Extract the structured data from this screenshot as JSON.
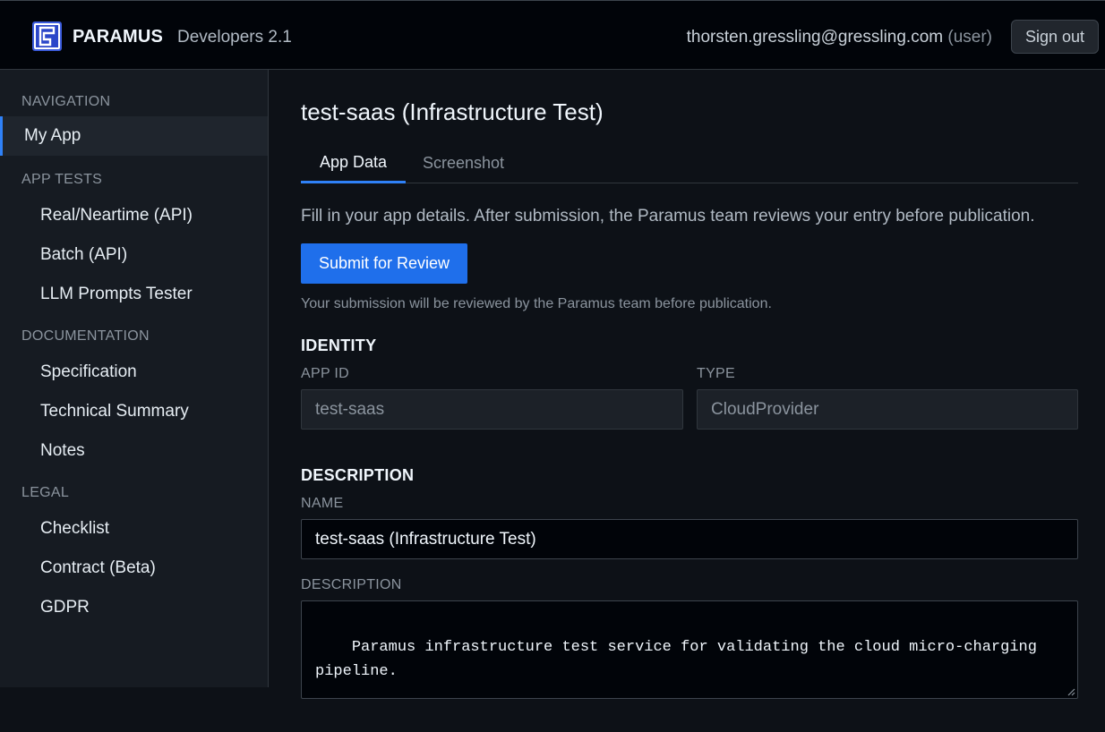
{
  "header": {
    "brand": "PARAMUS",
    "subtitle": "Developers 2.1",
    "user_email": "thorsten.gressling@gressling.com",
    "user_role": "(user)",
    "signout_label": "Sign out"
  },
  "sidebar": {
    "sections": [
      {
        "title": "NAVIGATION",
        "items": [
          {
            "label": "My App",
            "active": true
          }
        ]
      },
      {
        "title": "APP TESTS",
        "items": [
          {
            "label": "Real/Neartime (API)"
          },
          {
            "label": "Batch (API)"
          },
          {
            "label": "LLM Prompts Tester"
          }
        ]
      },
      {
        "title": "DOCUMENTATION",
        "items": [
          {
            "label": "Specification"
          },
          {
            "label": "Technical Summary"
          },
          {
            "label": "Notes"
          }
        ]
      },
      {
        "title": "LEGAL",
        "items": [
          {
            "label": "Checklist"
          },
          {
            "label": "Contract (Beta)"
          },
          {
            "label": "GDPR"
          }
        ]
      }
    ]
  },
  "main": {
    "title": "test-saas (Infrastructure Test)",
    "tabs": [
      {
        "label": "App Data",
        "active": true
      },
      {
        "label": "Screenshot",
        "active": false
      }
    ],
    "intro": "Fill in your app details. After submission, the Paramus team reviews your entry before publication.",
    "submit_label": "Submit for Review",
    "submit_note": "Your submission will be reviewed by the Paramus team before publication.",
    "identity": {
      "heading": "IDENTITY",
      "app_id_label": "APP ID",
      "app_id_value": "test-saas",
      "type_label": "TYPE",
      "type_value": "CloudProvider"
    },
    "description": {
      "heading": "DESCRIPTION",
      "name_label": "NAME",
      "name_value": "test-saas (Infrastructure Test)",
      "desc_label": "DESCRIPTION",
      "desc_value": "Paramus infrastructure test service for validating the cloud micro-charging\npipeline."
    }
  },
  "colors": {
    "accent": "#2f81f7",
    "button": "#1f6feb",
    "background": "#0d1117",
    "sidebar": "#161b22"
  },
  "icons": {
    "logo": "paramus-logo-icon",
    "resize": "resize-handle-icon"
  }
}
